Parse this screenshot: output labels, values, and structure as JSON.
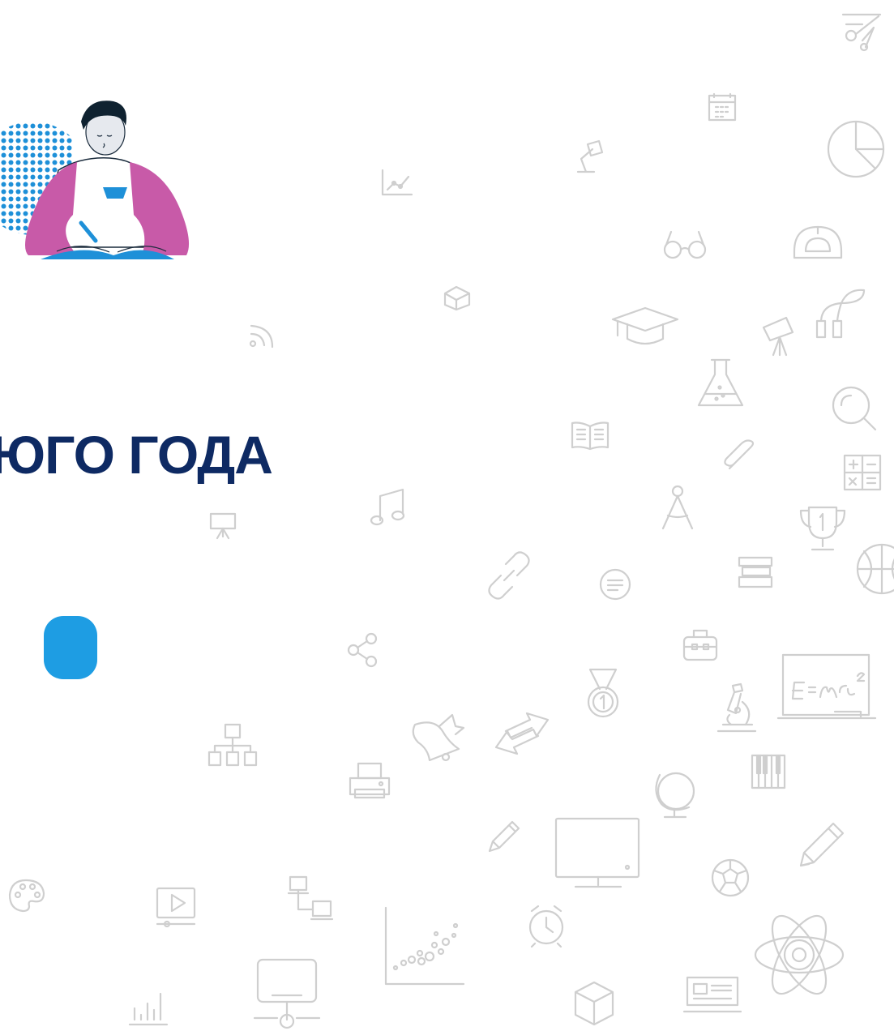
{
  "slide": {
    "title_fragment": "ЮГО ГОДА"
  },
  "colors": {
    "background": "#ffffff",
    "title": "#0e2a63",
    "logo": "#1e9de3",
    "icons": "#cfcfcf",
    "illustration_pink": "#c85aa8",
    "illustration_blue": "#1e90d8",
    "illustration_dots": "#1e90d8"
  },
  "icons": [
    "scissors-icon",
    "calendar-icon",
    "pie-chart-icon",
    "line-graph-icon",
    "desk-lamp-icon",
    "glasses-icon",
    "protractor-icon",
    "box-icon",
    "graduation-cap-icon",
    "wifi-signal-icon",
    "telescope-icon",
    "jump-rope-icon",
    "flask-icon",
    "magnifier-icon",
    "open-book-icon",
    "paperclip-icon",
    "calculator-icon",
    "music-note-icon",
    "presentation-board-icon",
    "compass-icon",
    "trophy-icon",
    "link-icon",
    "chat-bubble-icon",
    "books-stack-icon",
    "basketball-icon",
    "share-icon",
    "briefcase-icon",
    "medal-icon",
    "chalkboard-icon",
    "microscope-icon",
    "hierarchy-icon",
    "bell-icon",
    "swap-arrows-icon",
    "printer-icon",
    "globe-icon",
    "piano-icon",
    "pencil-icon",
    "monitor-icon",
    "football-icon",
    "palette-icon",
    "video-player-icon",
    "network-devices-icon",
    "scatter-plot-icon",
    "alarm-clock-icon",
    "atom-icon",
    "bar-chart-icon",
    "computer-network-icon",
    "cube-icon",
    "newspaper-icon"
  ]
}
